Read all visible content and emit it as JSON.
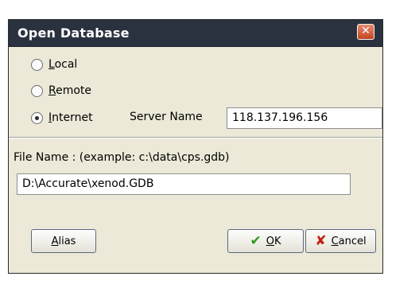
{
  "dialog": {
    "title": "Open Database",
    "close_glyph": "✕"
  },
  "connection": {
    "local_label": "Local",
    "remote_label": "Remote",
    "internet_label": "Internet",
    "selected": "internet",
    "server_name_label": "Server Name",
    "server_name_value": "118.137.196.156"
  },
  "file": {
    "label": "File Name :  (example: c:\\data\\cps.gdb)",
    "value": "D:\\Accurate\\xenod.GDB"
  },
  "buttons": {
    "alias_label": "Alias",
    "ok_label": "OK",
    "cancel_label": "Cancel",
    "ok_icon": "checkmark-icon",
    "cancel_icon": "x-icon"
  },
  "colors": {
    "titlebar": "#2b323f",
    "window_bg": "#ece9d8",
    "close_button": "#c1441f",
    "ok_icon": "#2e9a1e",
    "cancel_icon": "#c32010"
  }
}
